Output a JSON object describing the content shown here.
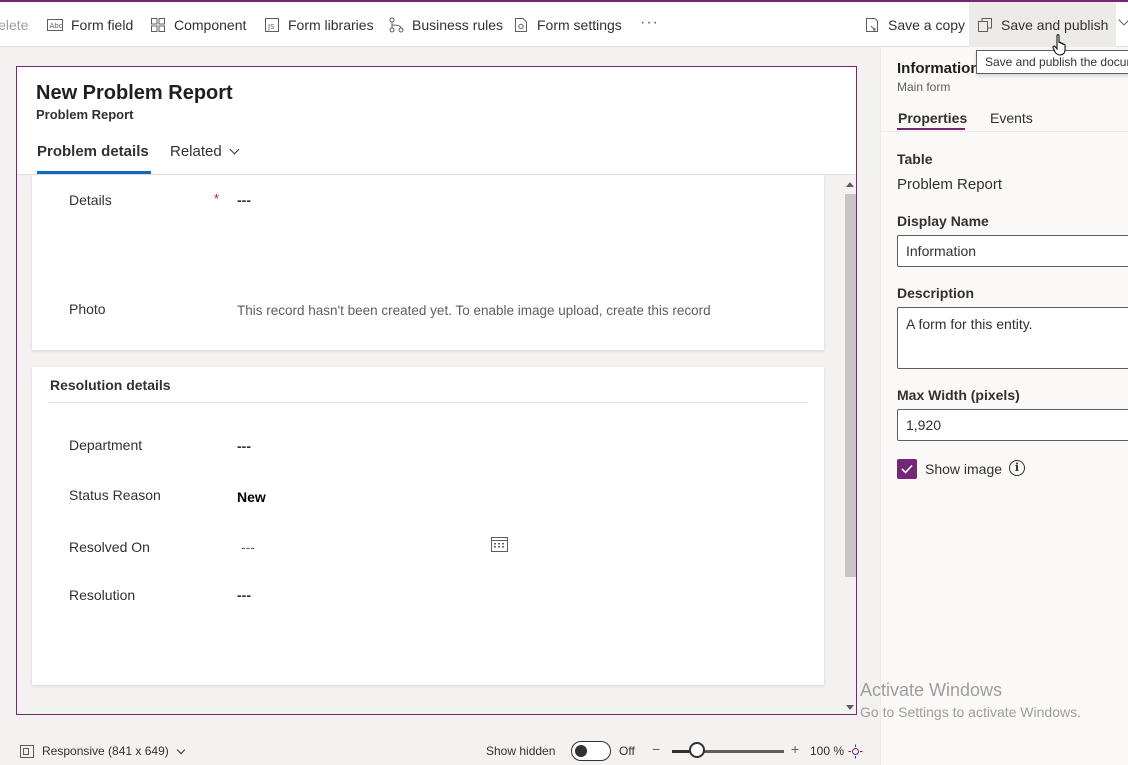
{
  "toolbar": {
    "delete_label": "Delete",
    "form_field_label": "Form field",
    "component_label": "Component",
    "form_libraries_label": "Form libraries",
    "business_rules_label": "Business rules",
    "form_settings_label": "Form settings",
    "more_label": "···",
    "save_copy_label": "Save a copy",
    "save_publish_label": "Save and publish"
  },
  "tooltip": {
    "text": "Save and publish the docur"
  },
  "form": {
    "title": "New Problem Report",
    "subtitle": "Problem Report",
    "tabs": [
      {
        "label": "Problem details"
      },
      {
        "label": "Related"
      }
    ],
    "general_section": {
      "details_label": "Details",
      "details_required_marker": "*",
      "details_value": "---",
      "photo_label": "Photo",
      "photo_value": "This record hasn't been created yet. To enable image upload, create this record"
    },
    "resolution_section": {
      "title": "Resolution details",
      "fields": [
        {
          "label": "Department",
          "value": "---"
        },
        {
          "label": "Status Reason",
          "value": "New"
        },
        {
          "label": "Resolved On",
          "value": "---"
        },
        {
          "label": "Resolution",
          "value": "---"
        }
      ]
    }
  },
  "bottom_bar": {
    "responsive_label": "Responsive (841 x 649)",
    "show_hidden_label": "Show hidden",
    "toggle_state": "Off",
    "zoom_minus": "−",
    "zoom_plus": "+",
    "zoom_level": "100 %",
    "zoom_fraction": 0.5
  },
  "panel": {
    "title": "Information",
    "subtitle": "Main form",
    "tabs": [
      {
        "label": "Properties"
      },
      {
        "label": "Events"
      }
    ],
    "table_label": "Table",
    "table_value": "Problem Report",
    "display_name_label": "Display Name",
    "display_name_value": "Information",
    "description_label": "Description",
    "description_value": "A form for this entity.",
    "max_width_label": "Max Width (pixels)",
    "max_width_value": "1,920",
    "show_image_label": "Show image",
    "show_image_checked": true
  },
  "watermark": {
    "line1": "Activate Windows",
    "line2": "Go to Settings to activate Windows."
  },
  "colors": {
    "accent": "#742774",
    "tab_underline": "#0f6cbd",
    "required": "#a4262c"
  }
}
